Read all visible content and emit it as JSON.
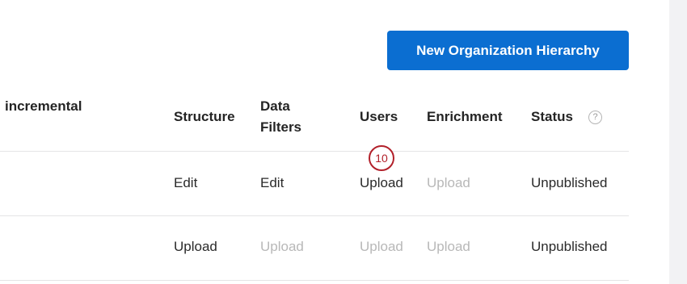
{
  "toolbar": {
    "new_button_label": "New Organization Hierarchy"
  },
  "table": {
    "headers": {
      "name": "incremental",
      "structure": "Structure",
      "data_filters_line1": "Data",
      "data_filters_line2": "Filters",
      "users": "Users",
      "enrichment": "Enrichment",
      "status": "Status"
    },
    "help_icon_glyph": "?",
    "rows": [
      {
        "structure": "Edit",
        "data_filters": "Edit",
        "users": "Upload",
        "enrichment": "Upload",
        "status": "Unpublished",
        "enabled": {
          "structure": true,
          "data_filters": true,
          "users": true,
          "enrichment": false
        }
      },
      {
        "structure": "Upload",
        "data_filters": "Upload",
        "users": "Upload",
        "enrichment": "Upload",
        "status": "Unpublished",
        "enabled": {
          "structure": true,
          "data_filters": false,
          "users": false,
          "enrichment": false
        }
      }
    ]
  },
  "annotation": {
    "step_number": "10",
    "color": "#b2202a"
  },
  "colors": {
    "accent": "#0b6ed1",
    "disabled_text": "#b8b8b8",
    "divider": "#e4e4e6",
    "side_panel": "#f2f2f4"
  }
}
